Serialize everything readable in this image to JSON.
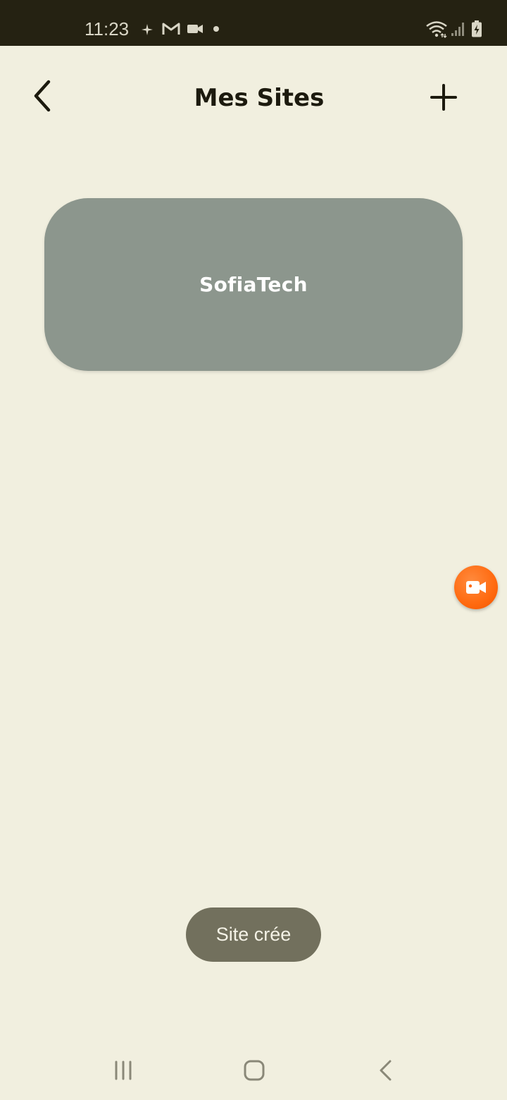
{
  "status_bar": {
    "time": "11:23",
    "left_icons": [
      "sparkle-icon",
      "gmail-icon",
      "video-camera-icon",
      "dot-icon"
    ],
    "right_icons": [
      "wifi-icon",
      "signal-icon",
      "battery-charging-icon"
    ]
  },
  "header": {
    "title": "Mes Sites",
    "back_icon": "chevron-left-icon",
    "add_icon": "plus-icon"
  },
  "sites": [
    {
      "label": "SofiaTech"
    }
  ],
  "floating_button": {
    "icon": "video-camera-icon",
    "color": "#FF6A10"
  },
  "toast": {
    "message": "Site crée"
  },
  "nav_bar": {
    "buttons": [
      "recent-apps-icon",
      "home-icon",
      "back-icon"
    ]
  },
  "colors": {
    "background": "#F1EFDF",
    "status_bar": "#252212",
    "card": "#8C968D",
    "toast": "#72705D",
    "fab": "#FF6A10"
  }
}
